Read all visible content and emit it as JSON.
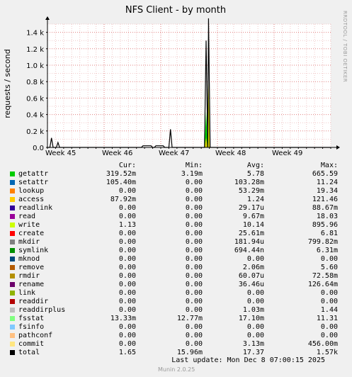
{
  "chart_data": {
    "type": "area",
    "title": "NFS Client - by month",
    "ylabel": "requests / second",
    "side_label": "RRDTOOL / TOBI OETIKER",
    "y_ticks": [
      {
        "value": 0,
        "label": "0.0"
      },
      {
        "value": 200,
        "label": "0.2 k"
      },
      {
        "value": 400,
        "label": "0.4 k"
      },
      {
        "value": 600,
        "label": "0.6 k"
      },
      {
        "value": 800,
        "label": "0.8 k"
      },
      {
        "value": 1000,
        "label": "1.0 k"
      },
      {
        "value": 1200,
        "label": "1.2 k"
      },
      {
        "value": 1400,
        "label": "1.4 k"
      }
    ],
    "ylim": [
      0,
      1500
    ],
    "xlim": [
      0,
      35
    ],
    "x_ticks": [
      {
        "x": 0,
        "label": "Week 45"
      },
      {
        "x": 7,
        "label": "Week 46"
      },
      {
        "x": 14,
        "label": "Week 47"
      },
      {
        "x": 21,
        "label": "Week 48"
      },
      {
        "x": 28,
        "label": "Week 49"
      }
    ],
    "grid": true,
    "series": [
      {
        "name": "total",
        "color": "#000000",
        "line": true,
        "points": [
          [
            -1,
            0
          ],
          [
            0.3,
            0
          ],
          [
            0.5,
            115
          ],
          [
            0.7,
            0
          ],
          [
            1.1,
            0
          ],
          [
            1.3,
            60
          ],
          [
            1.5,
            0
          ],
          [
            11.6,
            0
          ],
          [
            11.8,
            20
          ],
          [
            12.8,
            20
          ],
          [
            13.0,
            0
          ],
          [
            13.2,
            0
          ],
          [
            13.4,
            20
          ],
          [
            14.3,
            20
          ],
          [
            14.5,
            0
          ],
          [
            15.0,
            0
          ],
          [
            15.2,
            220
          ],
          [
            15.4,
            0
          ],
          [
            19.4,
            0
          ],
          [
            19.6,
            1300
          ],
          [
            19.8,
            0
          ],
          [
            19.9,
            1570
          ],
          [
            20.1,
            0
          ],
          [
            35,
            0
          ]
        ]
      },
      {
        "name": "getattr",
        "color": "#00cc00",
        "line": false,
        "points": [
          [
            -1,
            0
          ],
          [
            19.4,
            0
          ],
          [
            19.6,
            440
          ],
          [
            19.8,
            0
          ],
          [
            19.9,
            660
          ],
          [
            20.1,
            0
          ],
          [
            35,
            0
          ]
        ]
      },
      {
        "name": "fsstat",
        "color": "#cccc00",
        "line": false,
        "points": [
          [
            -1,
            0
          ],
          [
            19.4,
            0
          ],
          [
            19.6,
            120
          ],
          [
            19.8,
            0
          ],
          [
            19.9,
            810
          ],
          [
            20.1,
            0
          ],
          [
            35,
            0
          ]
        ]
      }
    ]
  },
  "legend": {
    "headers": {
      "cur": "Cur:",
      "min": "Min:",
      "avg": "Avg:",
      "max": "Max:"
    },
    "rows": [
      {
        "name": "getattr",
        "color": "#00cc00",
        "cur": "319.52m",
        "min": "3.19m",
        "avg": "5.78",
        "max": "665.59"
      },
      {
        "name": "setattr",
        "color": "#0066b3",
        "cur": "105.40m",
        "min": "0.00",
        "avg": "103.28m",
        "max": "11.24"
      },
      {
        "name": "lookup",
        "color": "#ff8000",
        "cur": "0.00",
        "min": "0.00",
        "avg": "53.29m",
        "max": "19.34"
      },
      {
        "name": "access",
        "color": "#ffcc00",
        "cur": "87.92m",
        "min": "0.00",
        "avg": "1.24",
        "max": "121.46"
      },
      {
        "name": "readlink",
        "color": "#330099",
        "cur": "0.00",
        "min": "0.00",
        "avg": "29.17u",
        "max": "88.67m"
      },
      {
        "name": "read",
        "color": "#990099",
        "cur": "0.00",
        "min": "0.00",
        "avg": "9.67m",
        "max": "18.03"
      },
      {
        "name": "write",
        "color": "#ccff00",
        "cur": "1.13",
        "min": "0.00",
        "avg": "10.14",
        "max": "895.96"
      },
      {
        "name": "create",
        "color": "#ff0000",
        "cur": "0.00",
        "min": "0.00",
        "avg": "25.61m",
        "max": "6.81"
      },
      {
        "name": "mkdir",
        "color": "#808080",
        "cur": "0.00",
        "min": "0.00",
        "avg": "181.94u",
        "max": "799.82m"
      },
      {
        "name": "symlink",
        "color": "#008f00",
        "cur": "0.00",
        "min": "0.00",
        "avg": "694.44n",
        "max": "6.31m"
      },
      {
        "name": "mknod",
        "color": "#00487d",
        "cur": "0.00",
        "min": "0.00",
        "avg": "0.00",
        "max": "0.00"
      },
      {
        "name": "remove",
        "color": "#b35a00",
        "cur": "0.00",
        "min": "0.00",
        "avg": "2.06m",
        "max": "5.60"
      },
      {
        "name": "rmdir",
        "color": "#b38f00",
        "cur": "0.00",
        "min": "0.00",
        "avg": "60.07u",
        "max": "72.58m"
      },
      {
        "name": "rename",
        "color": "#6b006b",
        "cur": "0.00",
        "min": "0.00",
        "avg": "36.46u",
        "max": "126.64m"
      },
      {
        "name": "link",
        "color": "#8fb300",
        "cur": "0.00",
        "min": "0.00",
        "avg": "0.00",
        "max": "0.00"
      },
      {
        "name": "readdir",
        "color": "#b30000",
        "cur": "0.00",
        "min": "0.00",
        "avg": "0.00",
        "max": "0.00"
      },
      {
        "name": "readdirplus",
        "color": "#bebebe",
        "cur": "0.00",
        "min": "0.00",
        "avg": "1.03m",
        "max": "1.44"
      },
      {
        "name": "fsstat",
        "color": "#80ff80",
        "cur": "13.33m",
        "min": "12.77m",
        "avg": "17.10m",
        "max": "11.31"
      },
      {
        "name": "fsinfo",
        "color": "#80c9ff",
        "cur": "0.00",
        "min": "0.00",
        "avg": "0.00",
        "max": "0.00"
      },
      {
        "name": "pathconf",
        "color": "#ffc080",
        "cur": "0.00",
        "min": "0.00",
        "avg": "0.00",
        "max": "0.00"
      },
      {
        "name": "commit",
        "color": "#ffe680",
        "cur": "0.00",
        "min": "0.00",
        "avg": "3.13m",
        "max": "456.00m"
      },
      {
        "name": "total",
        "color": "#000000",
        "cur": "1.65",
        "min": "15.96m",
        "avg": "17.37",
        "max": "1.57k"
      }
    ]
  },
  "footer": {
    "last_update": "Last update:  Mon Dec  8 07:00:15 2025",
    "generator": "Munin 2.0.25"
  }
}
